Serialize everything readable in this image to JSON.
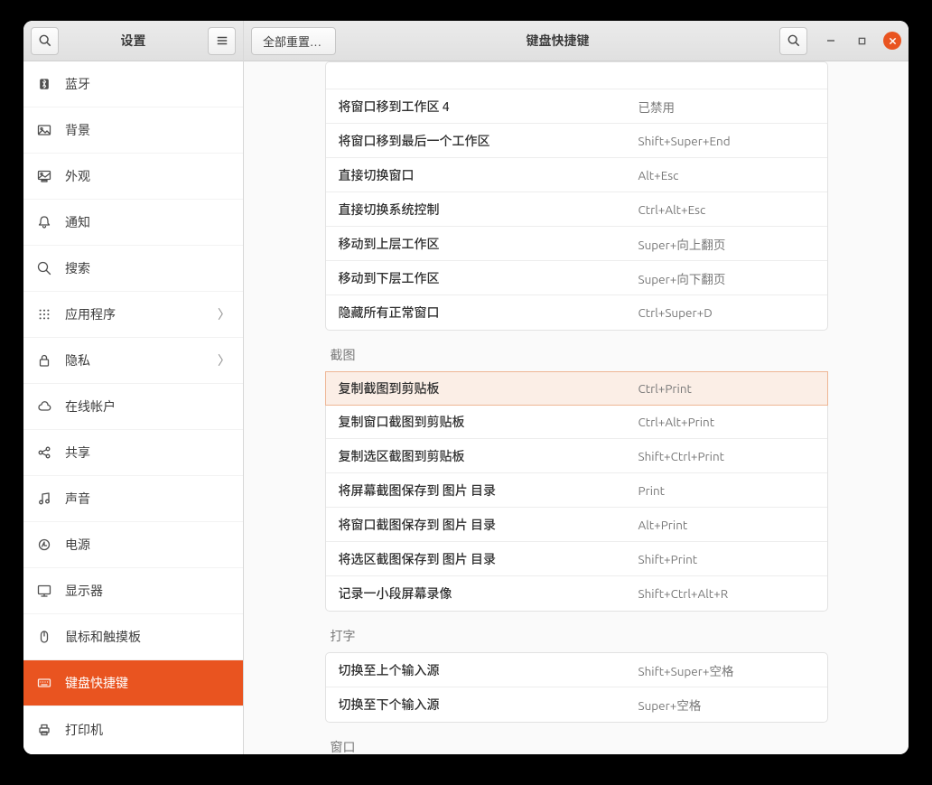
{
  "sidebar": {
    "title": "设置",
    "items": [
      {
        "id": "bluetooth",
        "label": "蓝牙",
        "icon": "bluetooth"
      },
      {
        "id": "background",
        "label": "背景",
        "icon": "background"
      },
      {
        "id": "appearance",
        "label": "外观",
        "icon": "appearance"
      },
      {
        "id": "notifications",
        "label": "通知",
        "icon": "bell"
      },
      {
        "id": "search",
        "label": "搜索",
        "icon": "search"
      },
      {
        "id": "applications",
        "label": "应用程序",
        "icon": "grid",
        "has_submenu": true
      },
      {
        "id": "privacy",
        "label": "隐私",
        "icon": "lock",
        "has_submenu": true
      },
      {
        "id": "online-accounts",
        "label": "在线帐户",
        "icon": "cloud"
      },
      {
        "id": "sharing",
        "label": "共享",
        "icon": "share"
      },
      {
        "id": "sound",
        "label": "声音",
        "icon": "music"
      },
      {
        "id": "power",
        "label": "电源",
        "icon": "power"
      },
      {
        "id": "displays",
        "label": "显示器",
        "icon": "display"
      },
      {
        "id": "mouse",
        "label": "鼠标和触摸板",
        "icon": "mouse"
      },
      {
        "id": "keyboard",
        "label": "键盘快捷键",
        "icon": "keyboard",
        "active": true
      },
      {
        "id": "printers",
        "label": "打印机",
        "icon": "printer"
      }
    ]
  },
  "panel": {
    "title": "键盘快捷键",
    "reset_label": "全部重置…"
  },
  "sections": [
    {
      "title_hidden": true,
      "rows": [
        {
          "name": "",
          "key": "",
          "cut": true
        },
        {
          "name": "将窗口移到工作区 4",
          "key": "已禁用"
        },
        {
          "name": "将窗口移到最后一个工作区",
          "key": "Shift+Super+End"
        },
        {
          "name": "直接切换窗口",
          "key": "Alt+Esc"
        },
        {
          "name": "直接切换系统控制",
          "key": "Ctrl+Alt+Esc"
        },
        {
          "name": "移动到上层工作区",
          "key": "Super+向上翻页"
        },
        {
          "name": "移动到下层工作区",
          "key": "Super+向下翻页"
        },
        {
          "name": "隐藏所有正常窗口",
          "key": "Ctrl+Super+D"
        }
      ]
    },
    {
      "title": "截图",
      "rows": [
        {
          "name": "复制截图到剪贴板",
          "key": "Ctrl+Print",
          "highlight": true
        },
        {
          "name": "复制窗口截图到剪贴板",
          "key": "Ctrl+Alt+Print"
        },
        {
          "name": "复制选区截图到剪贴板",
          "key": "Shift+Ctrl+Print"
        },
        {
          "name": "将屏幕截图保存到 图片 目录",
          "key": "Print"
        },
        {
          "name": "将窗口截图保存到 图片 目录",
          "key": "Alt+Print"
        },
        {
          "name": "将选区截图保存到 图片 目录",
          "key": "Shift+Print"
        },
        {
          "name": "记录一小段屏幕录像",
          "key": "Shift+Ctrl+Alt+R"
        }
      ]
    },
    {
      "title": "打字",
      "rows": [
        {
          "name": "切换至上个输入源",
          "key": "Shift+Super+空格"
        },
        {
          "name": "切换至下个输入源",
          "key": "Super+空格"
        }
      ]
    },
    {
      "title": "窗口",
      "rows": []
    }
  ]
}
